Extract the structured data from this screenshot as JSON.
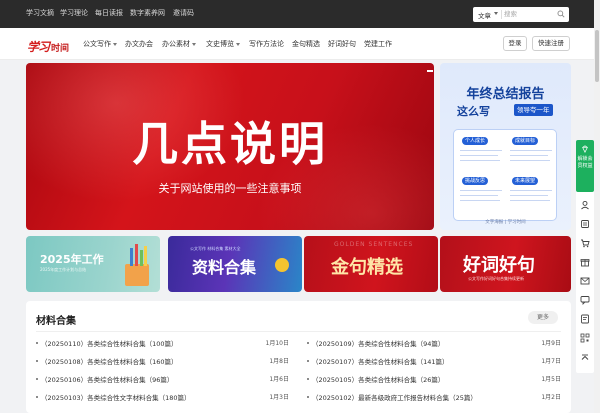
{
  "topbar": {
    "links": [
      "学习文摘",
      "学习理论",
      "每日读报",
      "数字素养网",
      "邀请码"
    ],
    "search": {
      "category": "文章",
      "placeholder": "搜索"
    }
  },
  "header": {
    "logo_script": "学习",
    "logo_text": "时间",
    "nav": [
      {
        "label": "公文写作",
        "dropdown": true
      },
      {
        "label": "办文办会",
        "dropdown": false
      },
      {
        "label": "办公素材",
        "dropdown": true
      },
      {
        "label": "文史博览",
        "dropdown": true
      },
      {
        "label": "写作方法论",
        "dropdown": false
      },
      {
        "label": "金句精选",
        "dropdown": false
      },
      {
        "label": "好词好句",
        "dropdown": false
      },
      {
        "label": "党建工作",
        "dropdown": false
      }
    ],
    "login_label": "登录",
    "register_label": "快速注册"
  },
  "hero": {
    "title": "几点说明",
    "subtitle": "关于网站使用的一些注意事项"
  },
  "side_banner": {
    "title": "年终总结报告",
    "subtitle": "这么写",
    "tag": "领导夸一年",
    "pills": [
      "个人成长",
      "成就目标",
      "挑战反思",
      "未来展望"
    ],
    "footer": "文字海报 | 学习时间"
  },
  "tiles": [
    {
      "title": "2025年工作",
      "subtitle": "2025年度工作计划与总结"
    },
    {
      "title": "资料合集",
      "subtitle": "公文写作 材料合集 素材大全"
    },
    {
      "title": "金句精选",
      "subtitle": "GOLDEN SENTENCES"
    },
    {
      "title": "好词好句",
      "subtitle": "公文写作好词好句合集持续更新"
    }
  ],
  "materials": {
    "heading": "材料合集",
    "more_label": "更多",
    "items": [
      {
        "text": "（20250110）各类综合性材料合集（100篇）",
        "date": "1月10日"
      },
      {
        "text": "（20250109）各类综合性材料合集（94篇）",
        "date": "1月9日"
      },
      {
        "text": "（20250108）各类综合性材料合集（160篇）",
        "date": "1月8日"
      },
      {
        "text": "（20250107）各类综合性材料合集（141篇）",
        "date": "1月7日"
      },
      {
        "text": "（20250106）各类综合性材料合集（96篇）",
        "date": "1月6日"
      },
      {
        "text": "（20250105）各类综合性材料合集（26篇）",
        "date": "1月5日"
      },
      {
        "text": "（20250103）各类综合性文字材料合集（180篇）",
        "date": "1月3日"
      },
      {
        "text": "（20250102）最新各级政府工作报告材料合集（25篇）",
        "date": "1月2日"
      }
    ]
  },
  "right_rail": {
    "promo_label": "解锁会员权益"
  },
  "colors": {
    "brand_red": "#d31c1c",
    "dark_top": "#2b2b2b",
    "rail_green": "#1db05e",
    "banner_blue": "#14429c"
  }
}
